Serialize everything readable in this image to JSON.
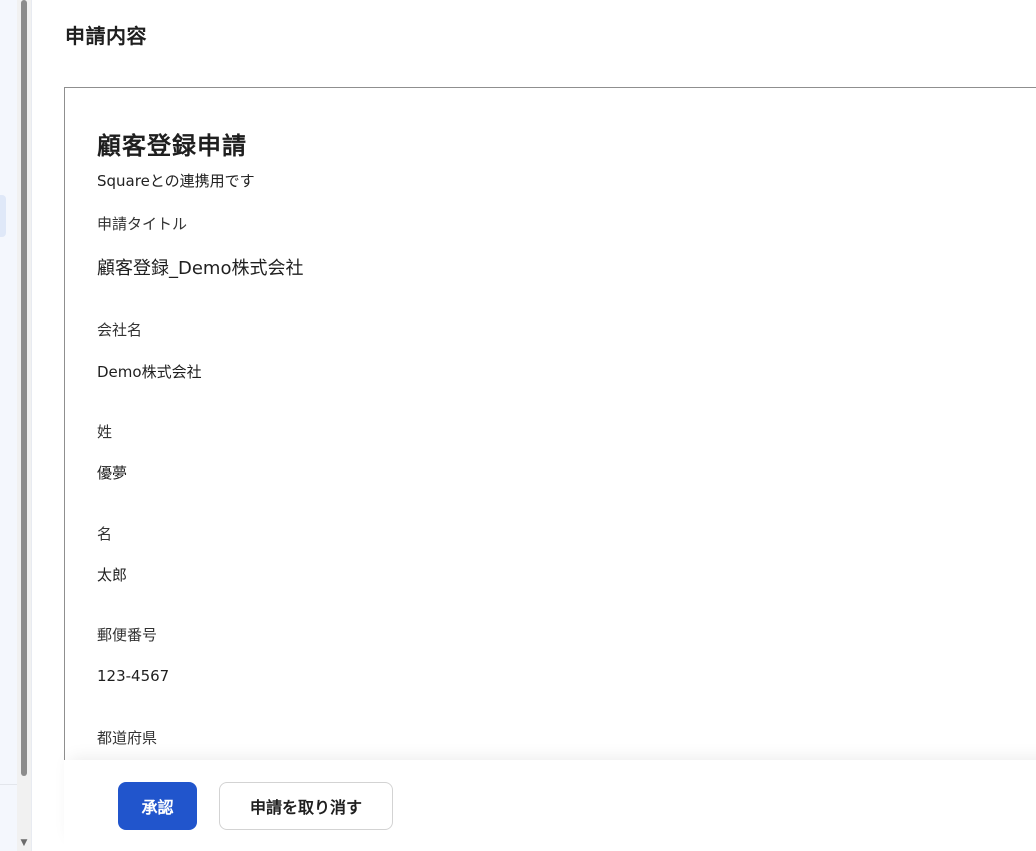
{
  "page": {
    "section_title": "申請内容"
  },
  "form": {
    "title": "顧客登録申請",
    "description": "Squareとの連携用です",
    "fields": [
      {
        "label": "申請タイトル",
        "value": "顧客登録_Demo株式会社"
      },
      {
        "label": "会社名",
        "value": "Demo株式会社"
      },
      {
        "label": "姓",
        "value": "優夢"
      },
      {
        "label": "名",
        "value": "太郎"
      },
      {
        "label": "郵便番号",
        "value": "123-4567"
      },
      {
        "label": "都道府県",
        "value": ""
      }
    ]
  },
  "actions": {
    "approve_label": "承認",
    "withdraw_label": "申請を取り消す"
  },
  "colors": {
    "primary": "#2155cc",
    "border": "#8f8f8f"
  }
}
